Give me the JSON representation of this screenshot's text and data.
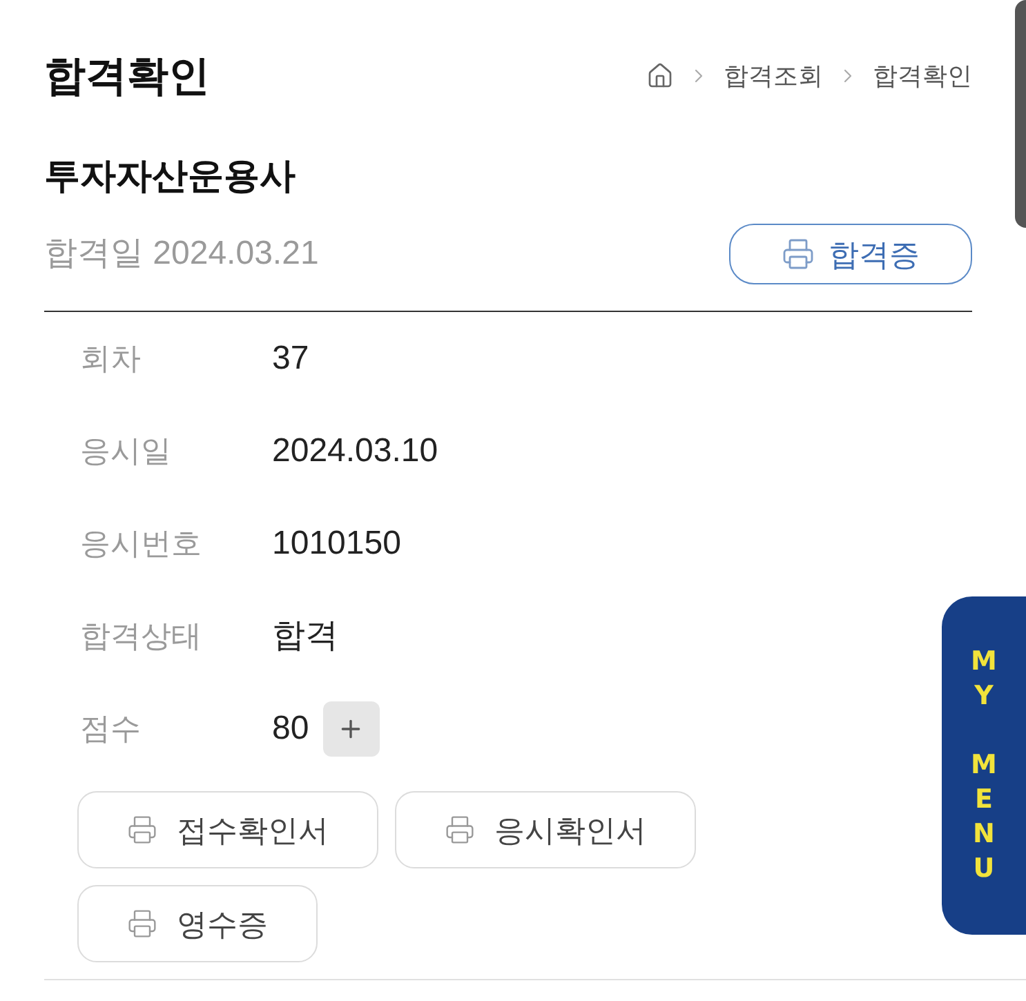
{
  "page": {
    "title": "합격확인"
  },
  "breadcrumb": [
    "합격조회",
    "합격확인"
  ],
  "exam": {
    "name": "투자자산운용사",
    "pass_date": "합격일 2024.03.21",
    "certificate_button": "합격증"
  },
  "details": [
    {
      "label": "회차",
      "value": "37",
      "kind": "plain"
    },
    {
      "label": "응시일",
      "value": "2024.03.10",
      "kind": "plain"
    },
    {
      "label": "응시번호",
      "value": "1010150",
      "kind": "plain"
    },
    {
      "label": "합격상태",
      "value": "합격",
      "kind": "plain"
    },
    {
      "label": "점수",
      "value": "80",
      "kind": "expandable"
    }
  ],
  "document_buttons": [
    "접수확인서",
    "응시확인서",
    "영수증"
  ],
  "side_tab": {
    "label": "MY MENU"
  }
}
